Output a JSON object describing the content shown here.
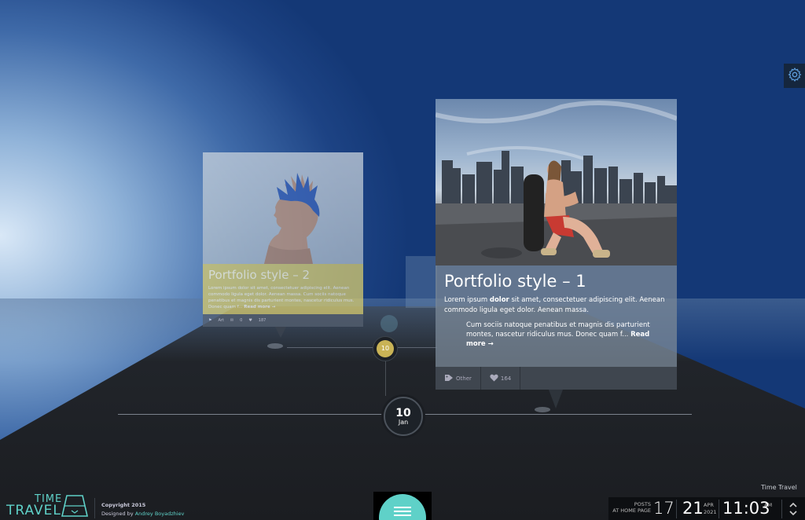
{
  "cards": [
    {
      "title": "Portfolio style – 2",
      "excerpt": "Lorem ipsum dolor sit amet, consectetuer adipiscing elit. Aenean commodo ligula eget dolor. Aenean massa. Cum sociis natoque penatibus et magnis dis parturient montes, nascetur ridiculus mus. Donec quam f...",
      "read_more": "Read more →",
      "comments": "0",
      "likes": "187",
      "tag": "Art"
    },
    {
      "title": "Portfolio style – 1",
      "paragraph1_before": "Lorem ipsum ",
      "paragraph1_bold": "dolor",
      "paragraph1_after": " sit amet, consectetuer adipiscing elit. Aenean commodo ligula eget dolor. Aenean massa.",
      "paragraph2": "Cum sociis natoque penatibus et magnis dis parturient montes, nascetur ridiculus mus. Donec quam f...",
      "read_more": "Read more →",
      "tag": "Other",
      "likes": "164"
    }
  ],
  "timeline": {
    "main_day": "10",
    "main_month": "Jan",
    "secondary_day": "10"
  },
  "footer": {
    "logo_line1": "TIME",
    "logo_line2": "TRAVEL",
    "copyright": "Copyright 2015",
    "designed_by": "Designed by ",
    "designer": "Andrey Boyadzhiev",
    "label": "Time Travel",
    "posts_label_1": "POSTS",
    "posts_label_2": "AT HOME PAGE",
    "posts_count": "17",
    "day": "21",
    "month": "APR",
    "year": "2021",
    "time": "11:03",
    "ampm": "AM"
  },
  "colors": {
    "accent": "#5fd1c8",
    "gold": "#c9b356"
  },
  "icons": [
    "gear-icon",
    "tag-icon",
    "comment-icon",
    "heart-icon",
    "menu-icon",
    "chevron-up-icon",
    "chevron-down-icon"
  ]
}
